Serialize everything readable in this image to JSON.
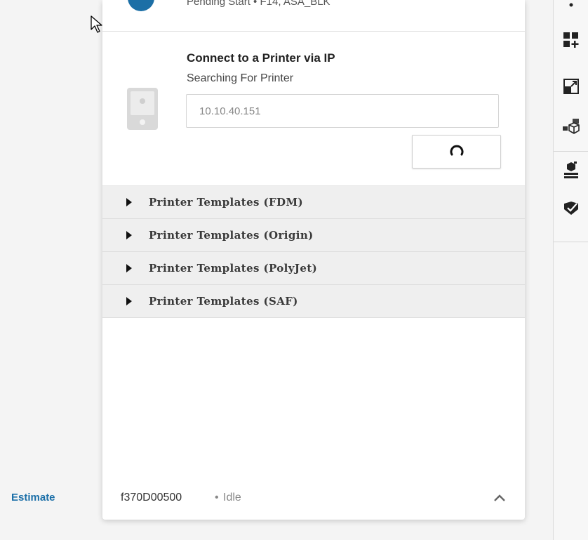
{
  "left": {
    "estimate_label": "Estimate"
  },
  "pending": {
    "text": "Pending Start • F14, ASA_BLK"
  },
  "connect": {
    "title": "Connect to a Printer via IP",
    "status": "Searching For Printer",
    "ip_value": "10.10.40.151"
  },
  "templates": [
    {
      "label": "Printer Templates (FDM)"
    },
    {
      "label": "Printer Templates (Origin)"
    },
    {
      "label": "Printer Templates (PolyJet)"
    },
    {
      "label": "Printer Templates (SAF)"
    }
  ],
  "footer": {
    "printer_name": "f370D00500",
    "separator": "•",
    "status": "Idle"
  },
  "toolbar": {
    "icons": [
      "add-grid-icon",
      "expand-icon",
      "parts-icon",
      "build-tray-icon",
      "verify-icon"
    ]
  },
  "colors": {
    "accent": "#1b6fa8",
    "panel_bg": "#ffffff",
    "template_bg": "#efefef"
  }
}
